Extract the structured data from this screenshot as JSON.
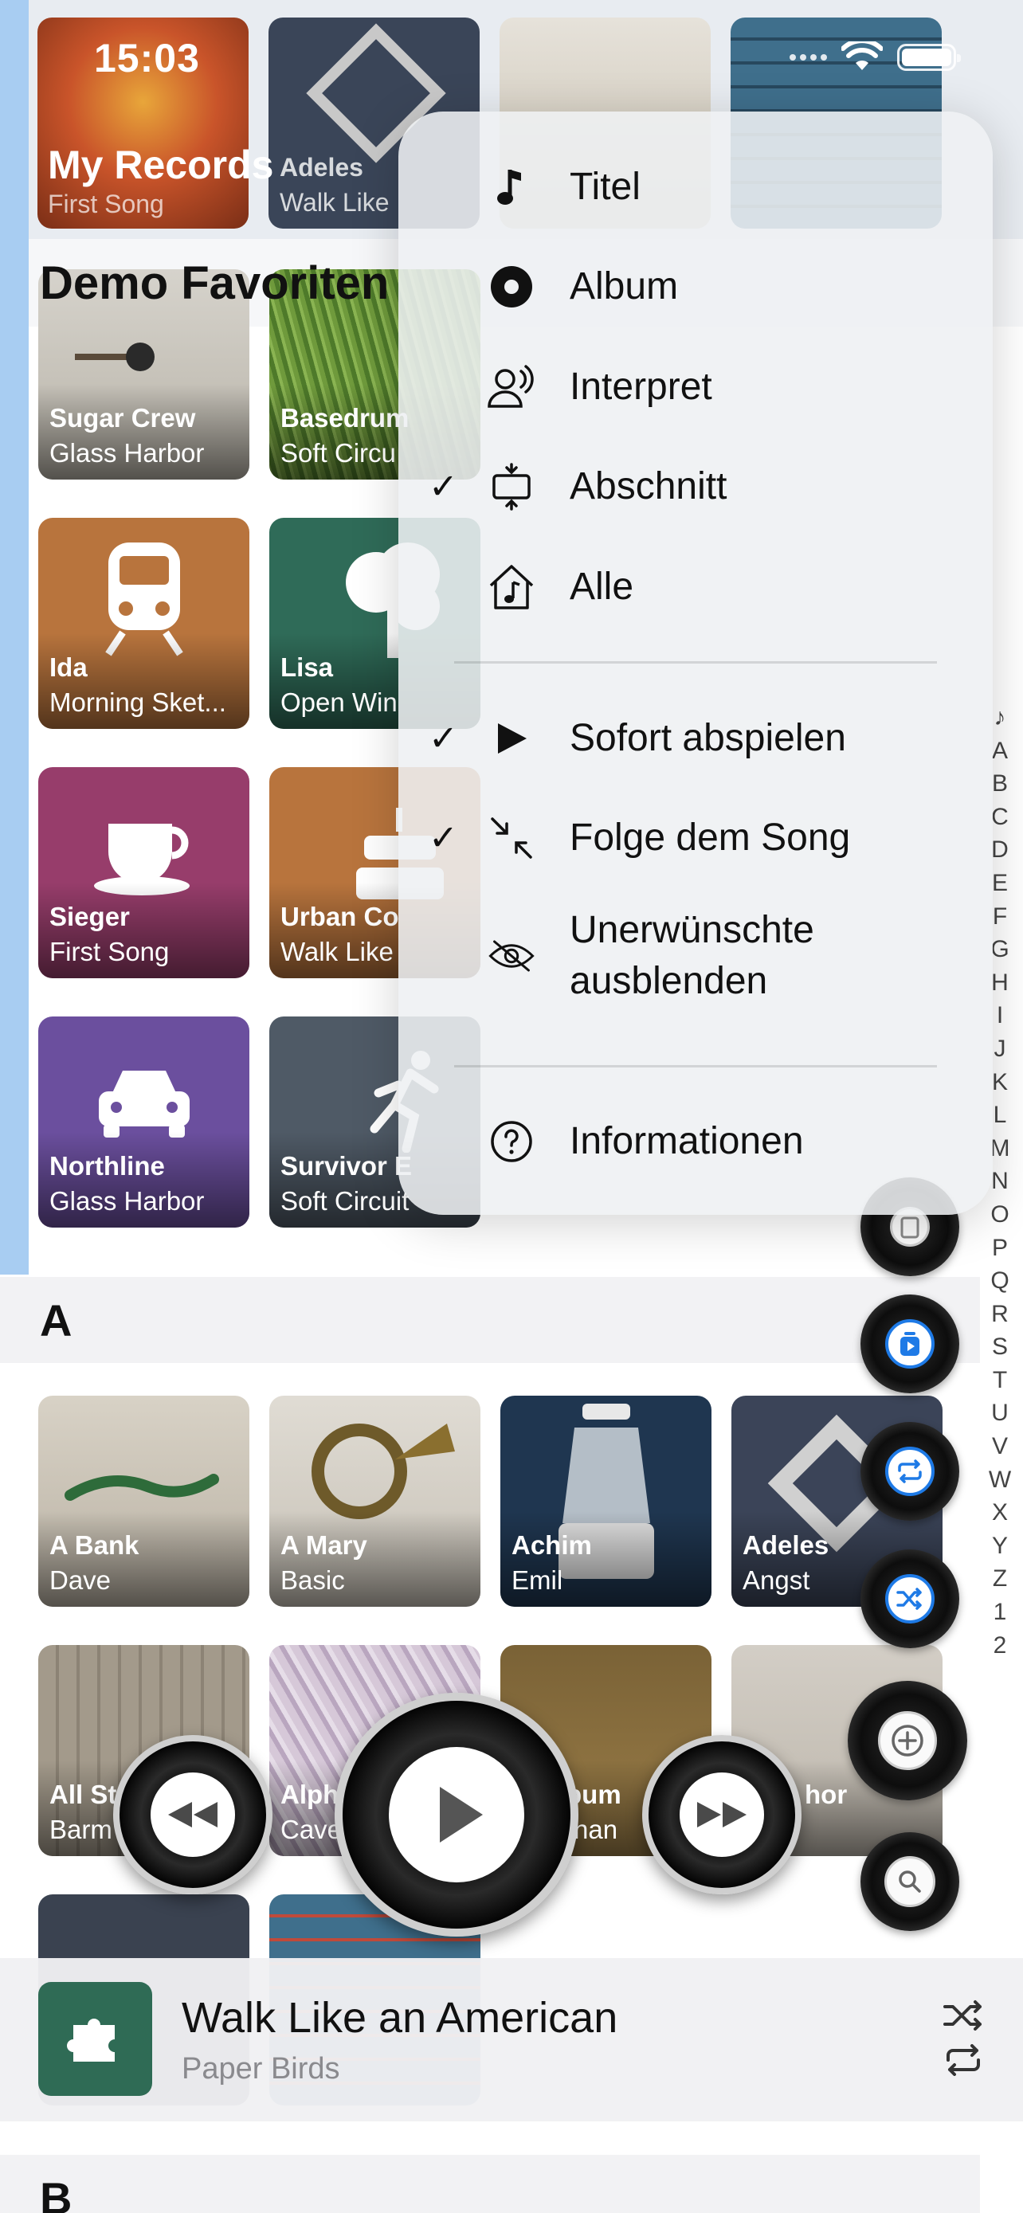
{
  "status_bar": {
    "time": "15:03"
  },
  "header": {
    "title": "My Records",
    "subtitle": "First Song",
    "top_tiles": [
      {
        "name": "",
        "artist": "",
        "color": "#b84a20"
      },
      {
        "name": "Adeles",
        "artist": "Walk Like",
        "color": "#3a4558"
      },
      {
        "name": "",
        "artist": "",
        "color": "#d8d2c6"
      },
      {
        "name": "",
        "artist": "",
        "color": "#3a6c8a"
      }
    ]
  },
  "favorites": {
    "title": "Demo Favoriten",
    "tiles": [
      {
        "name": "Sugar Crew",
        "artist": "Glass Harbor",
        "color": "#8f8f8a",
        "icon": "pin"
      },
      {
        "name": "Basedrum",
        "artist": "Soft Circu",
        "color": "#5f8a3c",
        "icon": "grass"
      },
      {
        "name": "Ida",
        "artist": "Morning Sket...",
        "color": "#b8743d",
        "icon": "train"
      },
      {
        "name": "Lisa",
        "artist": "Open Win",
        "color": "#2f6b58",
        "icon": "tree"
      },
      {
        "name": "Sieger",
        "artist": "First Song",
        "color": "#973d6b",
        "icon": "cup"
      },
      {
        "name": "Urban Co",
        "artist": "Walk Like",
        "color": "#b8743d",
        "icon": "cake"
      },
      {
        "name": "Northline",
        "artist": "Glass Harbor",
        "color": "#6b4f9e",
        "icon": "car"
      },
      {
        "name": "Survivor E",
        "artist": "Soft Circuit",
        "color": "#4f5a66",
        "icon": "runner"
      }
    ]
  },
  "sections": [
    {
      "letter": "A",
      "tiles": [
        {
          "name": "A Bank",
          "artist": "Dave",
          "color": "#c9c2b5"
        },
        {
          "name": "A Mary",
          "artist": "Basic",
          "color": "#d6d2cb"
        },
        {
          "name": "Achim",
          "artist": "Emil",
          "color": "#233a52"
        },
        {
          "name": "Adeles",
          "artist": "Angst",
          "color": "#3b4458"
        },
        {
          "name": "All St",
          "artist": "Barm",
          "color": "#9c9384"
        },
        {
          "name": "Alph",
          "artist": "Cave",
          "color": "#c9bcc9"
        },
        {
          "name": "bum",
          "artist": "han",
          "color": "#8a6a3a"
        },
        {
          "name": "hor",
          "artist": "",
          "color": "#c9c4bb"
        }
      ]
    },
    {
      "letter": "B",
      "tiles": []
    }
  ],
  "index_letters": [
    "♪",
    "A",
    "B",
    "C",
    "D",
    "E",
    "F",
    "G",
    "H",
    "I",
    "J",
    "K",
    "L",
    "M",
    "N",
    "O",
    "P",
    "Q",
    "R",
    "S",
    "T",
    "U",
    "V",
    "W",
    "X",
    "Y",
    "Z",
    "1",
    "2"
  ],
  "menu": {
    "group1": [
      {
        "label": "Titel",
        "icon": "music-note-icon",
        "checked": false
      },
      {
        "label": "Album",
        "icon": "album-disc-icon",
        "checked": false
      },
      {
        "label": "Interpret",
        "icon": "artist-icon",
        "checked": false
      },
      {
        "label": "Abschnitt",
        "icon": "section-icon",
        "checked": true
      },
      {
        "label": "Alle",
        "icon": "home-music-icon",
        "checked": false
      }
    ],
    "group2": [
      {
        "label": "Sofort abspielen",
        "icon": "play-icon",
        "checked": true
      },
      {
        "label": "Folge dem Song",
        "icon": "collapse-arrows-icon",
        "checked": true
      },
      {
        "label": "Unerwünschte ausblenden",
        "icon": "eye-slash-icon",
        "checked": false
      }
    ],
    "group3": [
      {
        "label": "Informationen",
        "icon": "question-circle-icon",
        "checked": false
      }
    ],
    "check_glyph": "✓"
  },
  "now_playing": {
    "title": "Walk Like an American",
    "artist": "Paper Birds",
    "art_color": "#2f6b55"
  },
  "colors": {
    "accent": "#1e7ae6",
    "side_strip": "#a8cdf2"
  }
}
